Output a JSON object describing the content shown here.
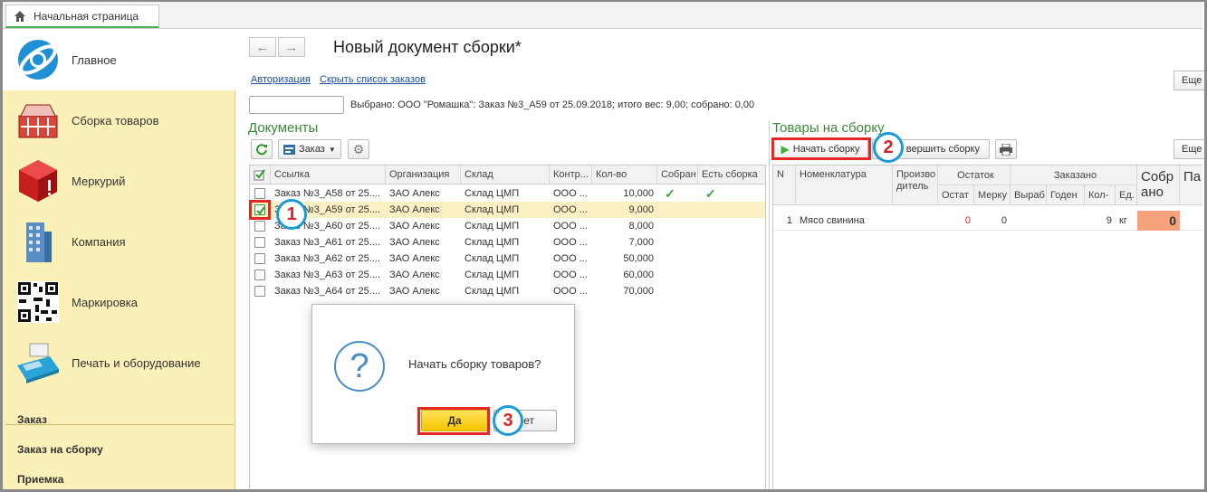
{
  "tabbar": {
    "home_tab": "Начальная страница"
  },
  "sidebar": {
    "sections": [
      {
        "label": "Главное",
        "icon": "globe-logo-icon"
      },
      {
        "label": "Сборка товаров",
        "icon": "basket-icon"
      },
      {
        "label": "Меркурий",
        "icon": "red-cube-icon"
      },
      {
        "label": "Компания",
        "icon": "building-icon"
      },
      {
        "label": "Маркировка",
        "icon": "qr-code-icon"
      },
      {
        "label": "Печать и оборудование",
        "icon": "pos-terminal-icon"
      }
    ],
    "links": [
      "Заказ",
      "Заказ на сборку",
      "Приемка"
    ]
  },
  "header": {
    "title": "Новый документ сборки*",
    "link_auth": "Авторизация",
    "link_hide": "Скрыть список заказов",
    "more": "Еще",
    "selected_info": "Выбрано: ООО \"Ромашка\": Заказ №3_А59 от 25.09.2018; итого вес: 9,00; собрано: 0,00"
  },
  "documents": {
    "title": "Документы",
    "order_btn": "Заказ",
    "columns": [
      "Ссылка",
      "Организация",
      "Склад",
      "Контр...",
      "Кол-во",
      "Собран",
      "Есть сборка"
    ],
    "rows": [
      {
        "ref": "Заказ №3_А58 от 25....",
        "org": "ЗАО Алекс",
        "wh": "Склад ЦМП",
        "contr": "ООО ...",
        "qty": "10,000",
        "checked": false,
        "assembled": true,
        "has_assembly": true
      },
      {
        "ref": "Заказ №3_А59 от 25....",
        "org": "ЗАО Алекс",
        "wh": "Склад ЦМП",
        "contr": "ООО ...",
        "qty": "9,000",
        "checked": true,
        "assembled": false,
        "has_assembly": false
      },
      {
        "ref": "Заказ №3_А60 от 25....",
        "org": "ЗАО Алекс",
        "wh": "Склад ЦМП",
        "contr": "ООО ...",
        "qty": "8,000",
        "checked": false,
        "assembled": false,
        "has_assembly": false
      },
      {
        "ref": "Заказ №3_А61 от 25....",
        "org": "ЗАО Алекс",
        "wh": "Склад ЦМП",
        "contr": "ООО ...",
        "qty": "7,000",
        "checked": false,
        "assembled": false,
        "has_assembly": false
      },
      {
        "ref": "Заказ №3_А62 от 25....",
        "org": "ЗАО Алекс",
        "wh": "Склад ЦМП",
        "contr": "ООО ...",
        "qty": "50,000",
        "checked": false,
        "assembled": false,
        "has_assembly": false
      },
      {
        "ref": "Заказ №3_А63 от 25....",
        "org": "ЗАО Алекс",
        "wh": "Склад ЦМП",
        "contr": "ООО ...",
        "qty": "60,000",
        "checked": false,
        "assembled": false,
        "has_assembly": false
      },
      {
        "ref": "Заказ №3_А64 от 25....",
        "org": "ЗАО Алекс",
        "wh": "Склад ЦМП",
        "contr": "ООО ...",
        "qty": "70,000",
        "checked": false,
        "assembled": false,
        "has_assembly": false
      }
    ]
  },
  "goods": {
    "title": "Товары на сборку",
    "start_btn": "Начать сборку",
    "finish_btn": "вершить сборку",
    "more": "Еще",
    "col_n": "N",
    "col_nomen": "Номенклатура",
    "col_producer": "Производитель",
    "col_remain": "Остаток",
    "col_remain_sub1": "Остат",
    "col_remain_sub2": "Мерку",
    "col_ordered": "Заказано",
    "col_ord_sub1": "Выраб",
    "col_ord_sub2": "Годен",
    "col_ord_sub3": "Кол-",
    "col_ord_sub4": "Ед.",
    "col_collected": "Собрано",
    "col_pa": "Па",
    "row": {
      "n": "1",
      "name": "Мясо свинина",
      "remain": "0",
      "merc": "0",
      "qty": "9",
      "unit": "кг",
      "collected": "0"
    }
  },
  "dialog": {
    "text": "Начать сборку товаров?",
    "yes": "Да",
    "no": "ет"
  },
  "markers": [
    "1",
    "2",
    "3"
  ],
  "colors": {
    "accent_green": "#3a8a3a",
    "yes_button": "#f5c400",
    "marker_red": "#e32626",
    "marker_blue": "#1a9bd7"
  }
}
